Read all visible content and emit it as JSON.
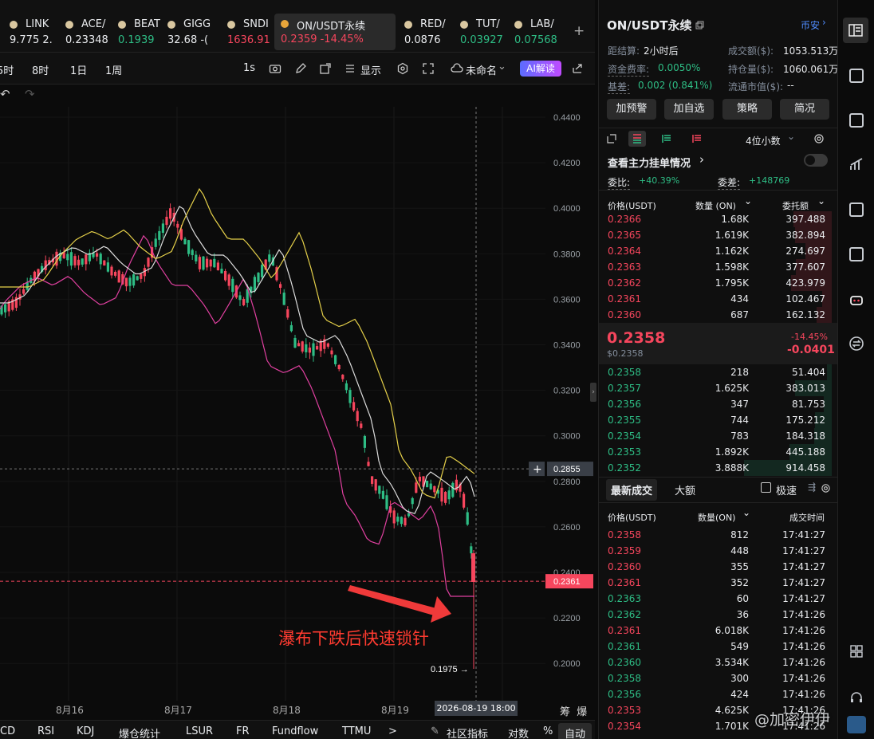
{
  "tickers": [
    {
      "name": "LINK",
      "price": "9.775 2.",
      "color": "white"
    },
    {
      "name": "ACE/",
      "price": "0.23348",
      "color": "white"
    },
    {
      "name": "BEAT",
      "price": "0.1939",
      "color": "green"
    },
    {
      "name": "GIGG",
      "price": "32.68 -(",
      "color": "white"
    },
    {
      "name": "SNDI",
      "price": "1636.91",
      "color": "red"
    },
    {
      "name": "ON/USDT永续",
      "price": "0.2359  -14.45%",
      "color": "red",
      "active": true
    },
    {
      "name": "RED/",
      "price": "0.0876",
      "color": "white"
    },
    {
      "name": "TUT/",
      "price": "0.03927",
      "color": "green"
    },
    {
      "name": "LAB/",
      "price": "0.07568",
      "color": "green"
    }
  ],
  "add_tab": "+",
  "toolbar": {
    "intervals": [
      "5时",
      "8时",
      "1日",
      "1周"
    ],
    "interval_1s": "1s",
    "display": "显示",
    "layout_name": "未命名",
    "ai": "AI解读"
  },
  "chart_data": {
    "type": "candlestick",
    "y_ticks": [
      "0.4400",
      "0.4200",
      "0.4000",
      "0.3800",
      "0.3600",
      "0.3400",
      "0.3200",
      "0.3000",
      "0.2800",
      "0.2600",
      "0.2400",
      "0.2200",
      "0.2000"
    ],
    "ylim": [
      0.19,
      0.445
    ],
    "x_ticks": [
      "8月16",
      "8月17",
      "8月18",
      "8月19"
    ],
    "crosshair_price": "0.2855",
    "crosshair_time": "2026-08-19 18:00",
    "last_price_tag": "0.2361",
    "low_label": "0.1975 →",
    "annotation": "瀑布下跌后快速锁针",
    "axis_right_icons": "筹  爆"
  },
  "indicators": [
    "CD",
    "RSI",
    "KDJ",
    "爆仓统计",
    "LSUR",
    "FR",
    "Fundflow",
    "TTMU"
  ],
  "indicator_more": ">",
  "community": "社区指标",
  "log_label": "对数",
  "pct_label": "%",
  "auto_label": "自动",
  "panel": {
    "title": "ON/USDT永续",
    "exchange": "币安",
    "settle_label": "距结算:",
    "settle_value": "2小时后",
    "volume_label": "成交额($):",
    "volume_value": "1053.513万",
    "funding_label": "资金费率:",
    "funding_value": "0.0050%",
    "oi_label": "持仓量($):",
    "oi_value": "1060.061万",
    "basis_label": "基差:",
    "basis_value": "0.002 (0.841%)",
    "mcap_label": "流通市值($):",
    "mcap_value": "--",
    "buttons": [
      "加预警",
      "加自选",
      "策略",
      "简况"
    ],
    "decimals": "4位小数",
    "main_orders": "查看主力挂单情况",
    "ratio_label": "委比:",
    "ratio_value": "+40.39%",
    "diff_label": "委差:",
    "diff_value": "+148769",
    "ob_headers": [
      "价格(USDT)",
      "数量 (ON)",
      "委托额"
    ],
    "asks": [
      [
        "0.2366",
        "1.68K",
        "397.488"
      ],
      [
        "0.2365",
        "1.619K",
        "382.894"
      ],
      [
        "0.2364",
        "1.162K",
        "274.697"
      ],
      [
        "0.2363",
        "1.598K",
        "377.607"
      ],
      [
        "0.2362",
        "1.795K",
        "423.979"
      ],
      [
        "0.2361",
        "434",
        "102.467"
      ],
      [
        "0.2360",
        "687",
        "162.132"
      ]
    ],
    "mid_price": "0.2358",
    "mid_usd": "$0.2358",
    "mid_pct": "-14.45%",
    "mid_change": "-0.0401",
    "bids": [
      [
        "0.2358",
        "218",
        "51.404"
      ],
      [
        "0.2357",
        "1.625K",
        "383.013"
      ],
      [
        "0.2356",
        "347",
        "81.753"
      ],
      [
        "0.2355",
        "744",
        "175.212"
      ],
      [
        "0.2354",
        "783",
        "184.318"
      ],
      [
        "0.2353",
        "1.892K",
        "445.188"
      ],
      [
        "0.2352",
        "3.888K",
        "914.458"
      ]
    ],
    "trades_tab": "最新成交",
    "big_tab": "大额",
    "fast_label": "极速",
    "trade_headers": [
      "价格(USDT)",
      "数量(ON)",
      "成交时间"
    ],
    "trades": [
      [
        "0.2358",
        "812",
        "17:41:27",
        "red"
      ],
      [
        "0.2359",
        "448",
        "17:41:27",
        "red"
      ],
      [
        "0.2360",
        "355",
        "17:41:27",
        "red"
      ],
      [
        "0.2361",
        "352",
        "17:41:27",
        "red"
      ],
      [
        "0.2363",
        "60",
        "17:41:27",
        "green"
      ],
      [
        "0.2362",
        "36",
        "17:41:26",
        "green"
      ],
      [
        "0.2361",
        "6.018K",
        "17:41:26",
        "red"
      ],
      [
        "0.2361",
        "549",
        "17:41:26",
        "green"
      ],
      [
        "0.2360",
        "3.534K",
        "17:41:26",
        "green"
      ],
      [
        "0.2358",
        "300",
        "17:41:26",
        "green"
      ],
      [
        "0.2356",
        "424",
        "17:41:26",
        "green"
      ],
      [
        "0.2353",
        "4.625K",
        "17:41:26",
        "red"
      ],
      [
        "0.2354",
        "1.701K",
        "17:41:26",
        "red"
      ]
    ],
    "watermark": "@加密伊伊"
  }
}
